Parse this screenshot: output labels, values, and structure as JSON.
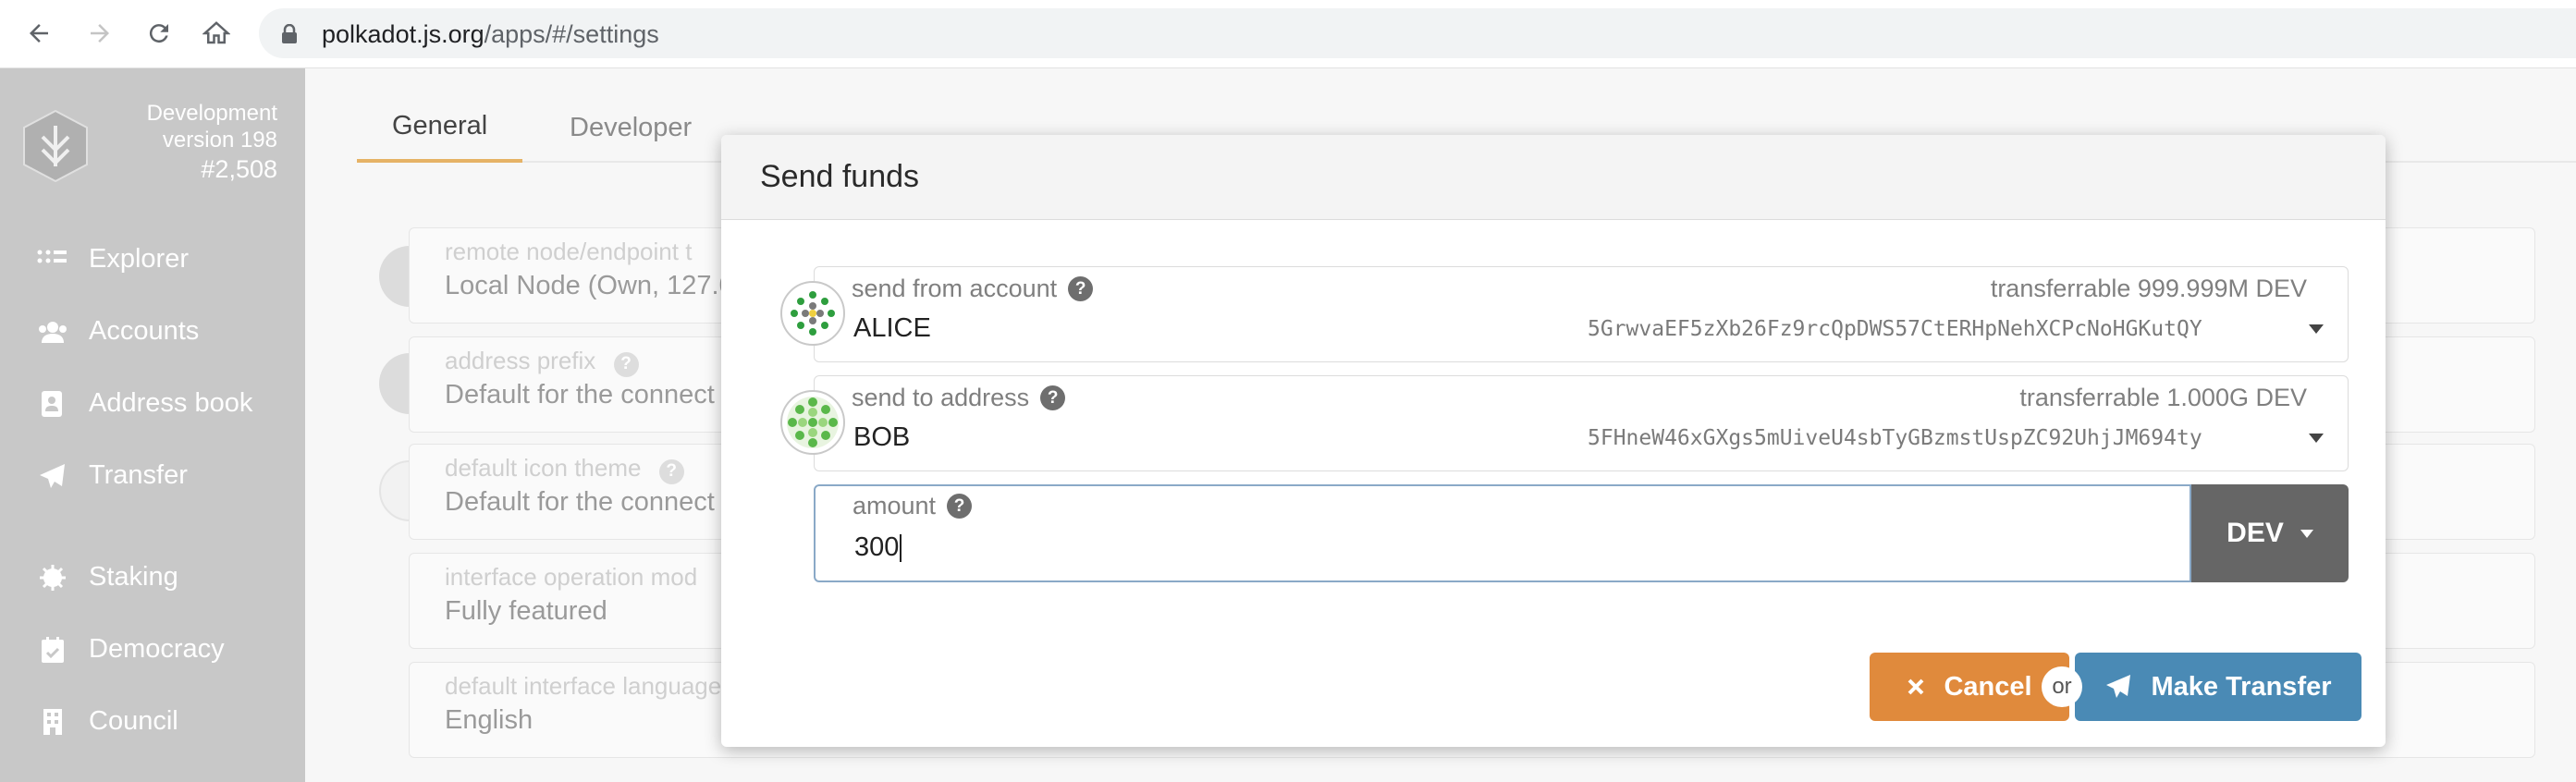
{
  "browser": {
    "url_host": "polkadot.js.org",
    "url_path": "/apps/#/settings"
  },
  "sidebar": {
    "chain_name": "Development",
    "version": "version 198",
    "block": "#2,508",
    "items": [
      {
        "label": "Explorer",
        "icon": "explorer-icon"
      },
      {
        "label": "Accounts",
        "icon": "accounts-icon"
      },
      {
        "label": "Address book",
        "icon": "address-book-icon"
      },
      {
        "label": "Transfer",
        "icon": "send-icon"
      },
      {
        "label": "Staking",
        "icon": "staking-icon"
      },
      {
        "label": "Democracy",
        "icon": "democracy-icon"
      },
      {
        "label": "Council",
        "icon": "council-icon"
      }
    ]
  },
  "settings": {
    "tabs": [
      "General",
      "Developer"
    ],
    "active_tab": "General",
    "fields": [
      {
        "label": "remote node/endpoint t",
        "value": "Local Node (Own, 127.0"
      },
      {
        "label": "address prefix",
        "value": "Default for the connect"
      },
      {
        "label": "default icon theme",
        "value": "Default for the connect"
      },
      {
        "label": "interface operation mod",
        "value": "Fully featured"
      },
      {
        "label": "default interface language",
        "value": "English"
      }
    ]
  },
  "modal": {
    "title": "Send funds",
    "from": {
      "label": "send from account",
      "transferrable": "transferrable 999.999M DEV",
      "name": "ALICE",
      "address": "5GrwvaEF5zXb26Fz9rcQpDWS57CtERHpNehXCPcNoHGKutQY"
    },
    "to": {
      "label": "send to address",
      "transferrable": "transferrable 1.000G DEV",
      "name": "BOB",
      "address": "5FHneW46xGXgs5mUiveU4sbTyGBzmstUspZC92UhjJM694ty"
    },
    "amount": {
      "label": "amount",
      "value": "300",
      "unit": "DEV"
    },
    "cancel_label": "Cancel",
    "or_label": "or",
    "submit_label": "Make Transfer"
  },
  "colors": {
    "sidebar_bg": "#c8c8c8",
    "cancel": "#e08a3c",
    "transfer": "#4a8ab5",
    "tab_accent": "#e6b366",
    "unit_bg": "#666666"
  }
}
